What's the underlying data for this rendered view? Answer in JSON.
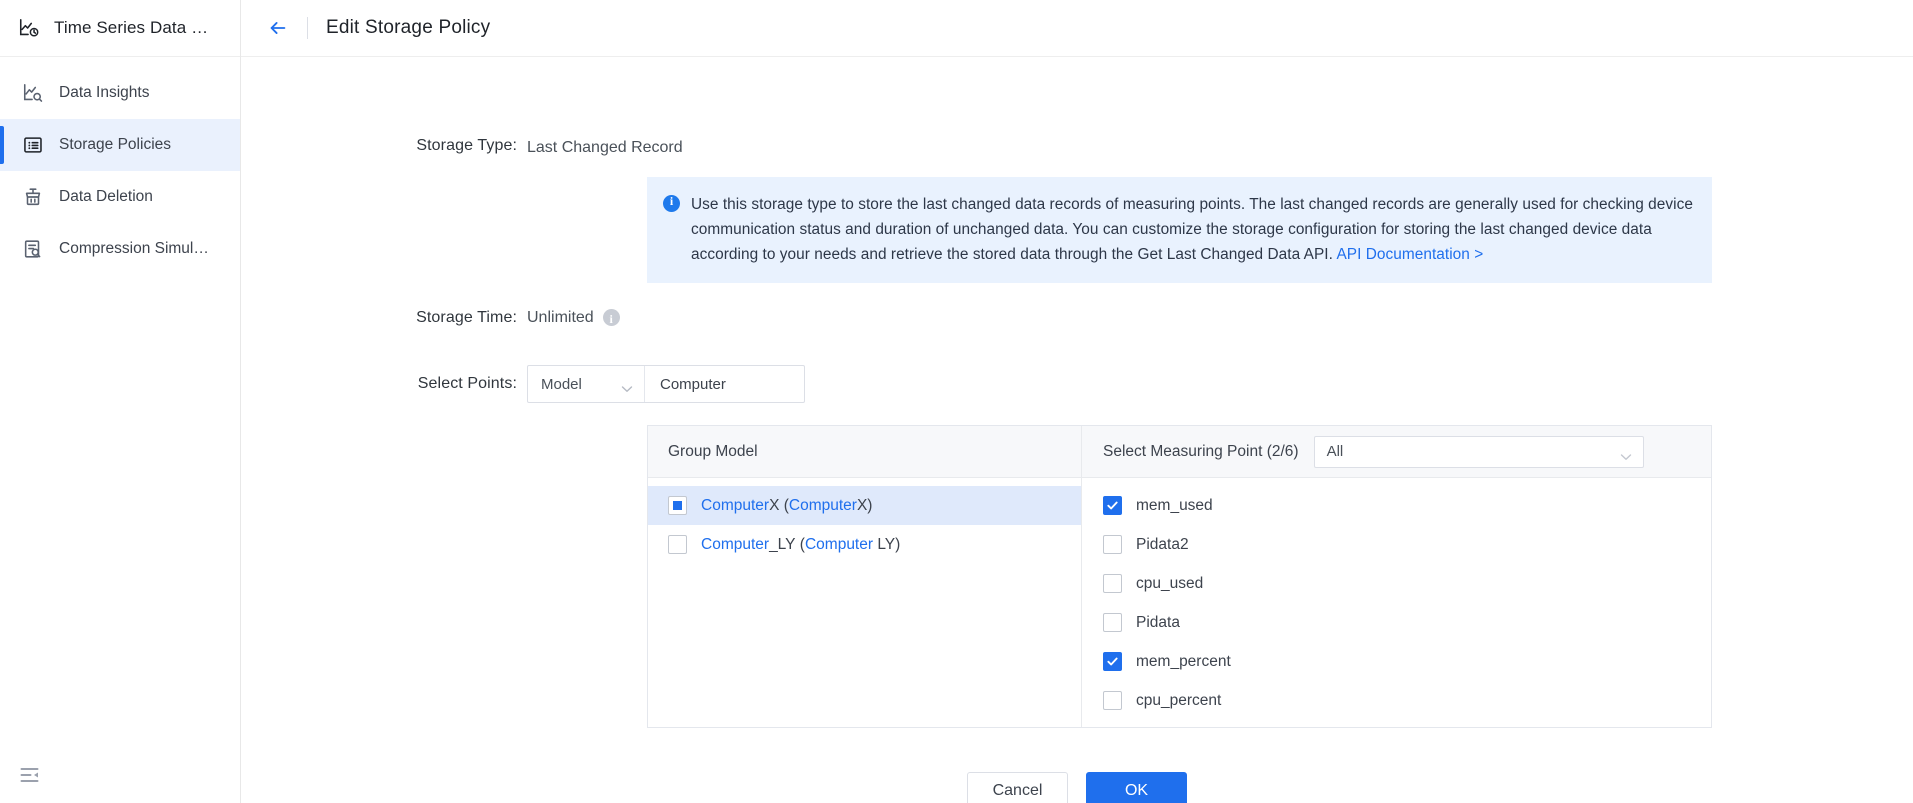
{
  "sidebar": {
    "brand": {
      "title": "Time Series Data …",
      "icon": "timeseries-chart-icon"
    },
    "items": [
      {
        "label": "Data Insights",
        "icon": "data-insights-icon",
        "active": false
      },
      {
        "label": "Storage Policies",
        "icon": "storage-policies-icon",
        "active": true
      },
      {
        "label": "Data Deletion",
        "icon": "data-deletion-icon",
        "active": false
      },
      {
        "label": "Compression Simul…",
        "icon": "compression-simulation-icon",
        "active": false
      }
    ],
    "collapse_icon": "collapse-sidebar-icon"
  },
  "topbar": {
    "back_icon": "back-arrow-icon",
    "title": "Edit Storage Policy"
  },
  "form": {
    "storage_type": {
      "label": "Storage Type:",
      "value": "Last Changed Record"
    },
    "infobox": {
      "icon": "info-circle-icon",
      "text": "Use this storage type to store the last changed data records of measuring points. The last changed records are generally used for checking device communication status and duration of unchanged data. You can customize the storage configuration for storing the last changed device data according to your needs and retrieve the stored data through the Get Last Changed Data API. ",
      "link_text": "API Documentation >",
      "background": "#e9f2fe",
      "link_color": "#1f6fed"
    },
    "storage_time": {
      "label": "Storage Time:",
      "value": "Unlimited",
      "info_icon": "info-tooltip-icon"
    },
    "select_points": {
      "label": "Select Points:",
      "scope_select": {
        "value": "Model",
        "icon": "chevron-down-icon"
      },
      "search": {
        "value": "Computer",
        "placeholder": "",
        "icon": "search-icon"
      }
    }
  },
  "picker": {
    "left_header": "Group Model",
    "right_header": "Select Measuring Point (2/6)",
    "filter_select": {
      "value": "All",
      "icon": "chevron-down-icon"
    },
    "groups": [
      {
        "match": "Computer",
        "suffix": "X",
        "paren_match": "Computer",
        "paren_suffix": "X",
        "state": "indeterminate",
        "selected_row": true
      },
      {
        "match": "Computer",
        "suffix": "_LY",
        "paren_match": "Computer",
        "paren_suffix": " LY",
        "state": "unchecked",
        "selected_row": false
      }
    ],
    "points": [
      {
        "label": "mem_used",
        "checked": true
      },
      {
        "label": "Pidata2",
        "checked": false
      },
      {
        "label": "cpu_used",
        "checked": false
      },
      {
        "label": "Pidata",
        "checked": false
      },
      {
        "label": "mem_percent",
        "checked": true
      },
      {
        "label": "cpu_percent",
        "checked": false
      }
    ]
  },
  "footer": {
    "cancel_label": "Cancel",
    "ok_label": "OK",
    "ok_color": "#1f6fed"
  }
}
